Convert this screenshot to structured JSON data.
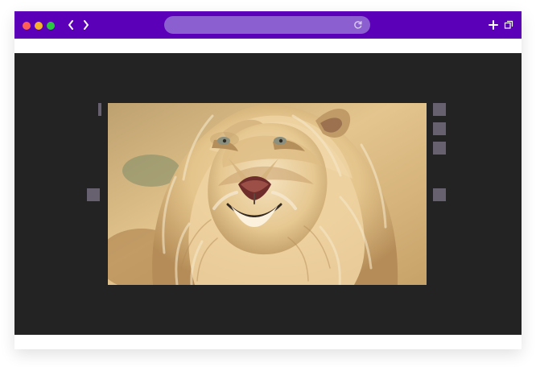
{
  "browser": {
    "address_value": "",
    "address_placeholder": ""
  },
  "icons": {
    "close": "close-dot",
    "minimize": "minimize-dot",
    "maximize": "maximize-dot",
    "back": "chevron-left-icon",
    "forward": "chevron-right-icon",
    "reload": "reload-icon",
    "new_tab": "plus-icon",
    "windows": "copy-windows-icon"
  },
  "colors": {
    "titlebar": "#5b00b8",
    "address_bar": "#8b5fcf",
    "stage_background": "#232323",
    "handle": "#66606f",
    "close": "#ff5f57",
    "minimize": "#f4b12d",
    "maximize": "#29c840",
    "photo_warm": "#d7b878"
  }
}
